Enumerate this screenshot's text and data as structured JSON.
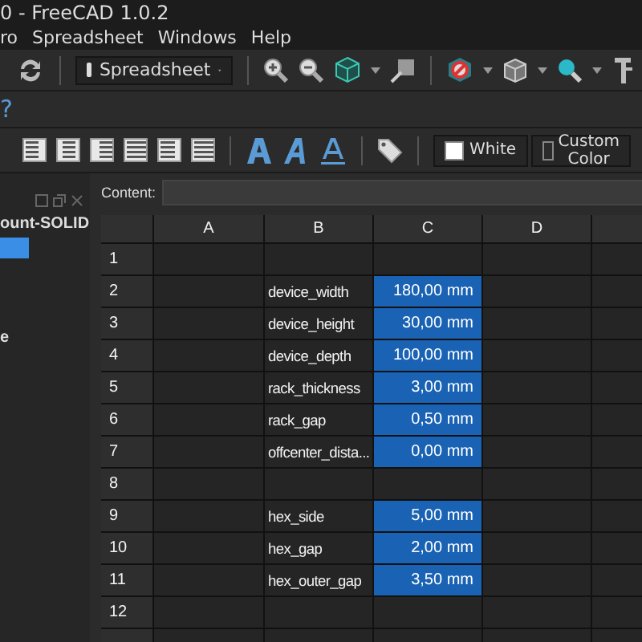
{
  "window": {
    "title": "0 - FreeCAD 1.0.2"
  },
  "menu": [
    "ro",
    "Spreadsheet",
    "Windows",
    "Help"
  ],
  "workbench": {
    "value": "Spreadsheet"
  },
  "help_glyph": "?",
  "color_buttons": [
    {
      "label": "White",
      "color": "#ffffff"
    },
    {
      "label": "Custom Color",
      "color": "#2b2b2b"
    }
  ],
  "tree": {
    "items": [
      {
        "label": "ount-SOLID",
        "kind": "text",
        "selected": false
      },
      {
        "kind": "blank",
        "selected": true
      },
      {
        "label": "e",
        "kind": "text",
        "selected": false
      }
    ]
  },
  "content": {
    "label": "Content:"
  },
  "sheet": {
    "columns": [
      "A",
      "B",
      "C",
      "D"
    ],
    "rows": [
      {
        "number": "1",
        "cells": [
          {
            "selected": false
          },
          {
            "selected": false
          },
          {
            "selected": false
          },
          {
            "selected": false
          },
          {
            "selected": false
          }
        ]
      },
      {
        "number": "2",
        "cells": [
          {
            "selected": false
          },
          {
            "text": "device_width",
            "selected": false
          },
          {
            "text": "180,00 mm",
            "selected": true
          },
          {
            "selected": false
          },
          {
            "selected": false
          }
        ]
      },
      {
        "number": "3",
        "cells": [
          {
            "selected": false
          },
          {
            "text": "device_height",
            "selected": false
          },
          {
            "text": "30,00 mm",
            "selected": true
          },
          {
            "selected": false
          },
          {
            "selected": false
          }
        ]
      },
      {
        "number": "4",
        "cells": [
          {
            "selected": false
          },
          {
            "text": "device_depth",
            "selected": false
          },
          {
            "text": "100,00 mm",
            "selected": true
          },
          {
            "selected": false
          },
          {
            "selected": false
          }
        ]
      },
      {
        "number": "5",
        "cells": [
          {
            "selected": false
          },
          {
            "text": "rack_thickness",
            "selected": false
          },
          {
            "text": "3,00 mm",
            "selected": true
          },
          {
            "selected": false
          },
          {
            "selected": false
          }
        ]
      },
      {
        "number": "6",
        "cells": [
          {
            "selected": false
          },
          {
            "text": "rack_gap",
            "selected": false
          },
          {
            "text": "0,50 mm",
            "selected": true
          },
          {
            "selected": false
          },
          {
            "selected": false
          }
        ]
      },
      {
        "number": "7",
        "cells": [
          {
            "selected": false
          },
          {
            "text": "offcenter_dista...",
            "selected": false
          },
          {
            "text": "0,00 mm",
            "selected": true
          },
          {
            "selected": false
          },
          {
            "selected": false
          }
        ]
      },
      {
        "number": "8",
        "cells": [
          {
            "selected": false
          },
          {
            "selected": false
          },
          {
            "selected": false
          },
          {
            "selected": false
          },
          {
            "selected": false
          }
        ]
      },
      {
        "number": "9",
        "cells": [
          {
            "selected": false
          },
          {
            "text": "hex_side",
            "selected": false
          },
          {
            "text": "5,00 mm",
            "selected": true
          },
          {
            "selected": false
          },
          {
            "selected": false
          }
        ]
      },
      {
        "number": "10",
        "cells": [
          {
            "selected": false
          },
          {
            "text": "hex_gap",
            "selected": false
          },
          {
            "text": "2,00 mm",
            "selected": true
          },
          {
            "selected": false
          },
          {
            "selected": false
          }
        ]
      },
      {
        "number": "11",
        "cells": [
          {
            "selected": false
          },
          {
            "text": "hex_outer_gap",
            "selected": false
          },
          {
            "text": "3,50 mm",
            "selected": true
          },
          {
            "selected": false
          },
          {
            "selected": false
          }
        ]
      },
      {
        "number": "12",
        "cells": [
          {
            "selected": false
          },
          {
            "selected": false
          },
          {
            "selected": false
          },
          {
            "selected": false
          },
          {
            "selected": false
          }
        ]
      }
    ]
  }
}
